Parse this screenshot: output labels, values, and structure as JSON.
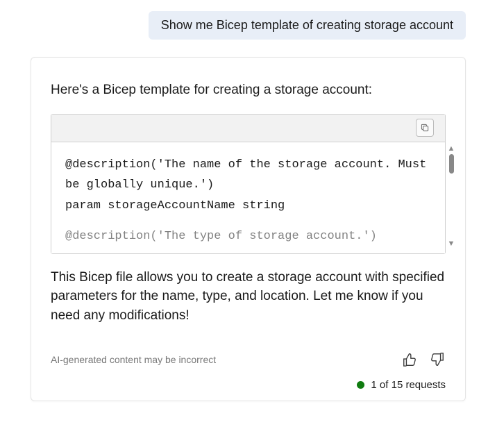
{
  "user_message": "Show me Bicep template of creating storage account",
  "response": {
    "intro": "Here's a Bicep template for creating a storage account:",
    "code": {
      "line1": "@description('The name of the storage account. Must be globally unique.')",
      "line2": "param storageAccountName string",
      "line3": "@description('The type of storage account.')"
    },
    "outro": "This Bicep file allows you to create a storage account with specified parameters for the name, type, and location. Let me know if you need any modifications!"
  },
  "footer": {
    "disclaimer": "AI-generated content may be incorrect",
    "requests": "1 of 15 requests"
  }
}
